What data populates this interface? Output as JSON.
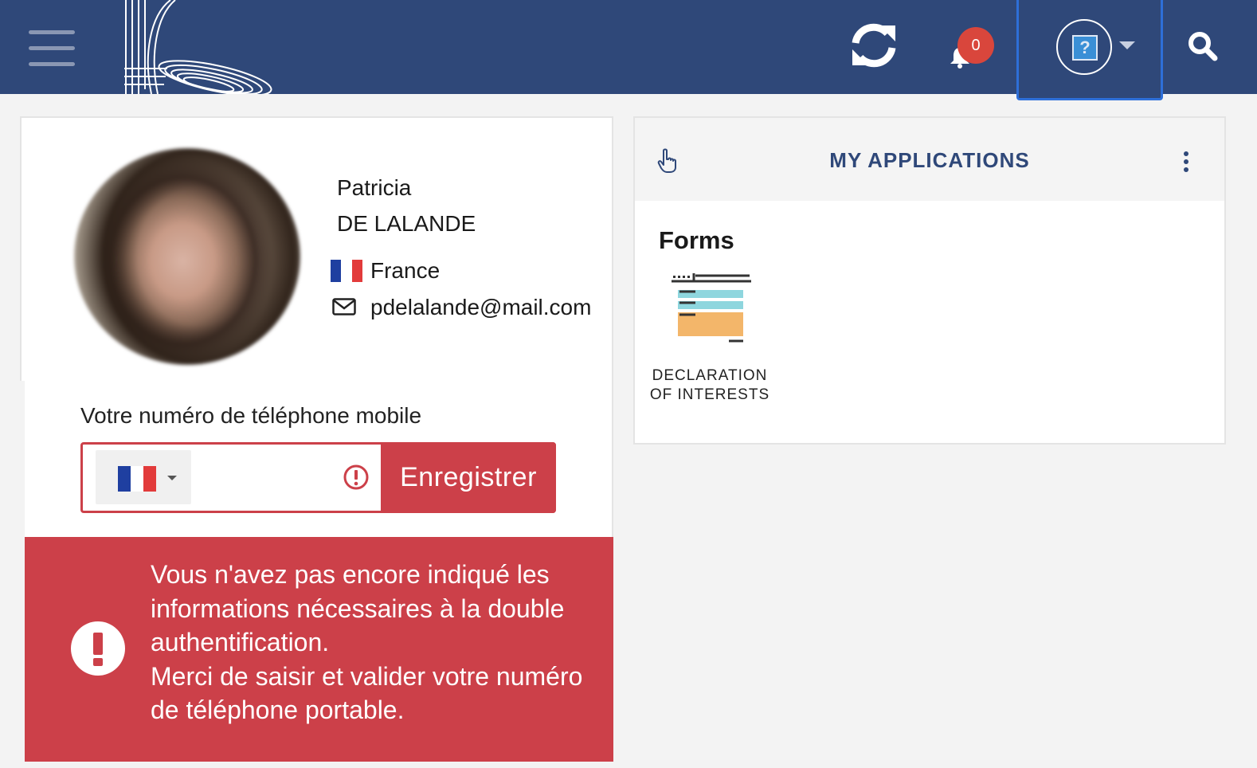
{
  "header": {
    "notification_count": "0",
    "help_symbol": "?",
    "icons": [
      "menu-icon",
      "institution-logo",
      "refresh-icon",
      "bell-icon",
      "help-icon",
      "chevron-down-icon",
      "search-icon"
    ],
    "colors": {
      "bar": "#2f4879",
      "badge": "#d9463c",
      "focus_outline": "#2e6fd8"
    }
  },
  "profile": {
    "first_name": "Patricia",
    "last_name": "DE LALANDE",
    "country": "France",
    "email": "pdelalande@mail.com"
  },
  "phone": {
    "label": "Votre numéro de téléphone mobile",
    "value": "",
    "save_label": "Enregistrer",
    "colors": {
      "error": "#cc4049"
    }
  },
  "alert": {
    "message_line1": "Vous n'avez pas encore indiqué les informations nécessaires à la double authentification.",
    "message_line2": "Merci de saisir et valider votre numéro de téléphone portable.",
    "color": "#cc4049"
  },
  "applications": {
    "title": "MY APPLICATIONS",
    "section": "Forms",
    "tiles": [
      {
        "label_line1": "DECLARATION",
        "label_line2": "OF INTERESTS",
        "icon": "form-icon"
      }
    ]
  }
}
